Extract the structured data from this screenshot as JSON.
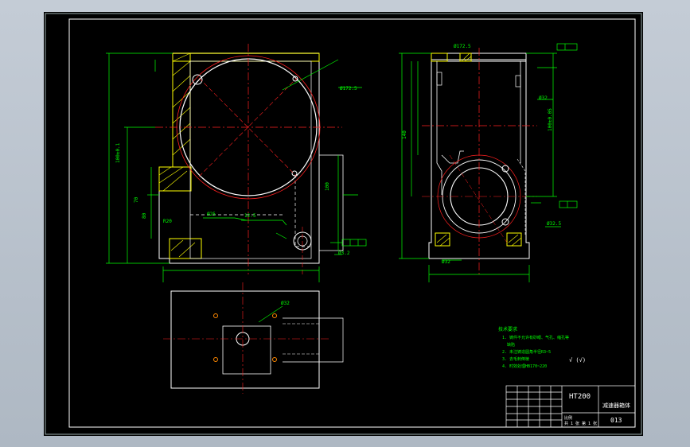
{
  "colors": {
    "outline": "#ffffff",
    "dimension": "#00ff00",
    "centerline": "#ff2020",
    "hatch": "#ffff00",
    "note": "#00ff00",
    "table": "#ffffff"
  },
  "labels": {
    "dim_bore_front": "Ø172.5",
    "dim_bore_side": "Ø172.5",
    "dim_hole_top": "Ø32",
    "dim_hole_bot": "Ø32",
    "dim_depth_a": "Ø25",
    "dim_depth_b": "Ø32",
    "dim_r": "R20",
    "dim_center": "12.5",
    "dim_bot_side": "Ø32.5",
    "dim_small": "Ø3.2"
  },
  "notes": {
    "title": "技术要求",
    "line1": "1. 铸件不允许有砂眼、气孔、缩孔等",
    "line2": "缺陷",
    "line3": "2. 未注铸造圆角半径R3~5",
    "line4": "3. 去毛刺倒棱",
    "line5": "4. 时效处理HB170~220"
  },
  "surface_mark": "√ (√)",
  "title_block": {
    "material": "HT200",
    "part_name": "减速器箱体",
    "drawing_no": "013",
    "scale_label": "比例",
    "sheet_label": "共 1 张 第 1 张"
  }
}
